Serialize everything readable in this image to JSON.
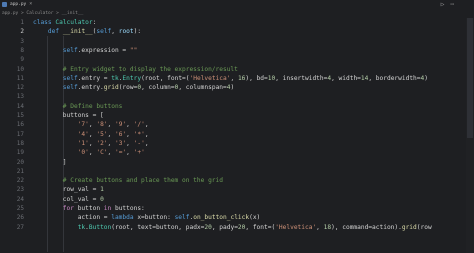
{
  "tab": {
    "label": "app.py",
    "close": "×"
  },
  "breadcrumb": "app.py > Calculator > __init__",
  "topbar": {
    "run_icon": "▷",
    "more_icon": "⋯"
  },
  "lines": [
    {
      "n": "1",
      "segments": [
        {
          "t": "class ",
          "c": "kw"
        },
        {
          "t": "Calculator",
          "c": "cls"
        },
        {
          "t": ":",
          "c": ""
        }
      ]
    },
    {
      "n": "2",
      "segments": [
        {
          "t": "    def ",
          "c": "kw"
        },
        {
          "t": "__init__",
          "c": "fn"
        },
        {
          "t": "(",
          "c": ""
        },
        {
          "t": "self",
          "c": "self"
        },
        {
          "t": ", ",
          "c": ""
        },
        {
          "t": "root",
          "c": "var"
        },
        {
          "t": "):",
          "c": ""
        }
      ]
    },
    {
      "n": "3",
      "segments": []
    },
    {
      "n": "8",
      "segments": [
        {
          "t": "        self",
          "c": "self"
        },
        {
          "t": ".expression = ",
          "c": ""
        },
        {
          "t": "\"\"",
          "c": "str"
        }
      ]
    },
    {
      "n": "9",
      "segments": []
    },
    {
      "n": "10",
      "segments": [
        {
          "t": "        # Entry widget to display the expression/result",
          "c": "cm"
        }
      ]
    },
    {
      "n": "11",
      "segments": [
        {
          "t": "        self",
          "c": "self"
        },
        {
          "t": ".entry = ",
          "c": ""
        },
        {
          "t": "tk",
          "c": "cls"
        },
        {
          "t": ".",
          "c": ""
        },
        {
          "t": "Entry",
          "c": "cls"
        },
        {
          "t": "(root, font=(",
          "c": ""
        },
        {
          "t": "'Helvetica'",
          "c": "str"
        },
        {
          "t": ", ",
          "c": ""
        },
        {
          "t": "16",
          "c": "num"
        },
        {
          "t": "), bd=",
          "c": ""
        },
        {
          "t": "10",
          "c": "num"
        },
        {
          "t": ", insertwidth=",
          "c": ""
        },
        {
          "t": "4",
          "c": "num"
        },
        {
          "t": ", width=",
          "c": ""
        },
        {
          "t": "14",
          "c": "num"
        },
        {
          "t": ", borderwidth=",
          "c": ""
        },
        {
          "t": "4",
          "c": "num"
        },
        {
          "t": ")",
          "c": ""
        }
      ]
    },
    {
      "n": "12",
      "segments": [
        {
          "t": "        self",
          "c": "self"
        },
        {
          "t": ".entry.",
          "c": ""
        },
        {
          "t": "grid",
          "c": "fn"
        },
        {
          "t": "(row=",
          "c": ""
        },
        {
          "t": "0",
          "c": "num"
        },
        {
          "t": ", column=",
          "c": ""
        },
        {
          "t": "0",
          "c": "num"
        },
        {
          "t": ", columnspan=",
          "c": ""
        },
        {
          "t": "4",
          "c": "num"
        },
        {
          "t": ")",
          "c": ""
        }
      ]
    },
    {
      "n": "13",
      "segments": []
    },
    {
      "n": "14",
      "segments": [
        {
          "t": "        # Define buttons",
          "c": "cm"
        }
      ]
    },
    {
      "n": "15",
      "segments": [
        {
          "t": "        buttons = [",
          "c": ""
        }
      ]
    },
    {
      "n": "16",
      "segments": [
        {
          "t": "            ",
          "c": ""
        },
        {
          "t": "'7'",
          "c": "str"
        },
        {
          "t": ", ",
          "c": ""
        },
        {
          "t": "'8'",
          "c": "str"
        },
        {
          "t": ", ",
          "c": ""
        },
        {
          "t": "'9'",
          "c": "str"
        },
        {
          "t": ", ",
          "c": ""
        },
        {
          "t": "'/'",
          "c": "str"
        },
        {
          "t": ",",
          "c": ""
        }
      ]
    },
    {
      "n": "17",
      "segments": [
        {
          "t": "            ",
          "c": ""
        },
        {
          "t": "'4'",
          "c": "str"
        },
        {
          "t": ", ",
          "c": ""
        },
        {
          "t": "'5'",
          "c": "str"
        },
        {
          "t": ", ",
          "c": ""
        },
        {
          "t": "'6'",
          "c": "str"
        },
        {
          "t": ", ",
          "c": ""
        },
        {
          "t": "'*'",
          "c": "str"
        },
        {
          "t": ",",
          "c": ""
        }
      ]
    },
    {
      "n": "18",
      "segments": [
        {
          "t": "            ",
          "c": ""
        },
        {
          "t": "'1'",
          "c": "str"
        },
        {
          "t": ", ",
          "c": ""
        },
        {
          "t": "'2'",
          "c": "str"
        },
        {
          "t": ", ",
          "c": ""
        },
        {
          "t": "'3'",
          "c": "str"
        },
        {
          "t": ", ",
          "c": ""
        },
        {
          "t": "'-'",
          "c": "str"
        },
        {
          "t": ",",
          "c": ""
        }
      ]
    },
    {
      "n": "19",
      "segments": [
        {
          "t": "            ",
          "c": ""
        },
        {
          "t": "'0'",
          "c": "str"
        },
        {
          "t": ", ",
          "c": ""
        },
        {
          "t": "'C'",
          "c": "str"
        },
        {
          "t": ", ",
          "c": ""
        },
        {
          "t": "'='",
          "c": "str"
        },
        {
          "t": ", ",
          "c": ""
        },
        {
          "t": "'+'",
          "c": "str"
        }
      ]
    },
    {
      "n": "20",
      "segments": [
        {
          "t": "        ]",
          "c": ""
        }
      ]
    },
    {
      "n": "21",
      "segments": []
    },
    {
      "n": "22",
      "segments": [
        {
          "t": "        # Create buttons and place them on the grid",
          "c": "cm"
        }
      ]
    },
    {
      "n": "23",
      "segments": [
        {
          "t": "        row_val = ",
          "c": ""
        },
        {
          "t": "1",
          "c": "num"
        }
      ]
    },
    {
      "n": "24",
      "segments": [
        {
          "t": "        col_val = ",
          "c": ""
        },
        {
          "t": "0",
          "c": "num"
        }
      ]
    },
    {
      "n": "25",
      "segments": [
        {
          "t": "        for ",
          "c": "kw2"
        },
        {
          "t": "button ",
          "c": ""
        },
        {
          "t": "in ",
          "c": "kw2"
        },
        {
          "t": "buttons:",
          "c": ""
        }
      ]
    },
    {
      "n": "26",
      "segments": [
        {
          "t": "            action = ",
          "c": ""
        },
        {
          "t": "lambda ",
          "c": "kw"
        },
        {
          "t": "x=button: ",
          "c": ""
        },
        {
          "t": "self",
          "c": "self"
        },
        {
          "t": ".",
          "c": ""
        },
        {
          "t": "on_button_click",
          "c": "fn"
        },
        {
          "t": "(x)",
          "c": ""
        }
      ]
    },
    {
      "n": "27",
      "segments": [
        {
          "t": "            ",
          "c": ""
        },
        {
          "t": "tk",
          "c": "cls"
        },
        {
          "t": ".",
          "c": ""
        },
        {
          "t": "Button",
          "c": "cls"
        },
        {
          "t": "(root, text=button, padx=",
          "c": ""
        },
        {
          "t": "20",
          "c": "num"
        },
        {
          "t": ", pady=",
          "c": ""
        },
        {
          "t": "20",
          "c": "num"
        },
        {
          "t": ", font=(",
          "c": ""
        },
        {
          "t": "'Helvetica'",
          "c": "str"
        },
        {
          "t": ", ",
          "c": ""
        },
        {
          "t": "18",
          "c": "num"
        },
        {
          "t": "), command=action).",
          "c": ""
        },
        {
          "t": "grid",
          "c": "fn"
        },
        {
          "t": "(row",
          "c": ""
        }
      ]
    }
  ]
}
